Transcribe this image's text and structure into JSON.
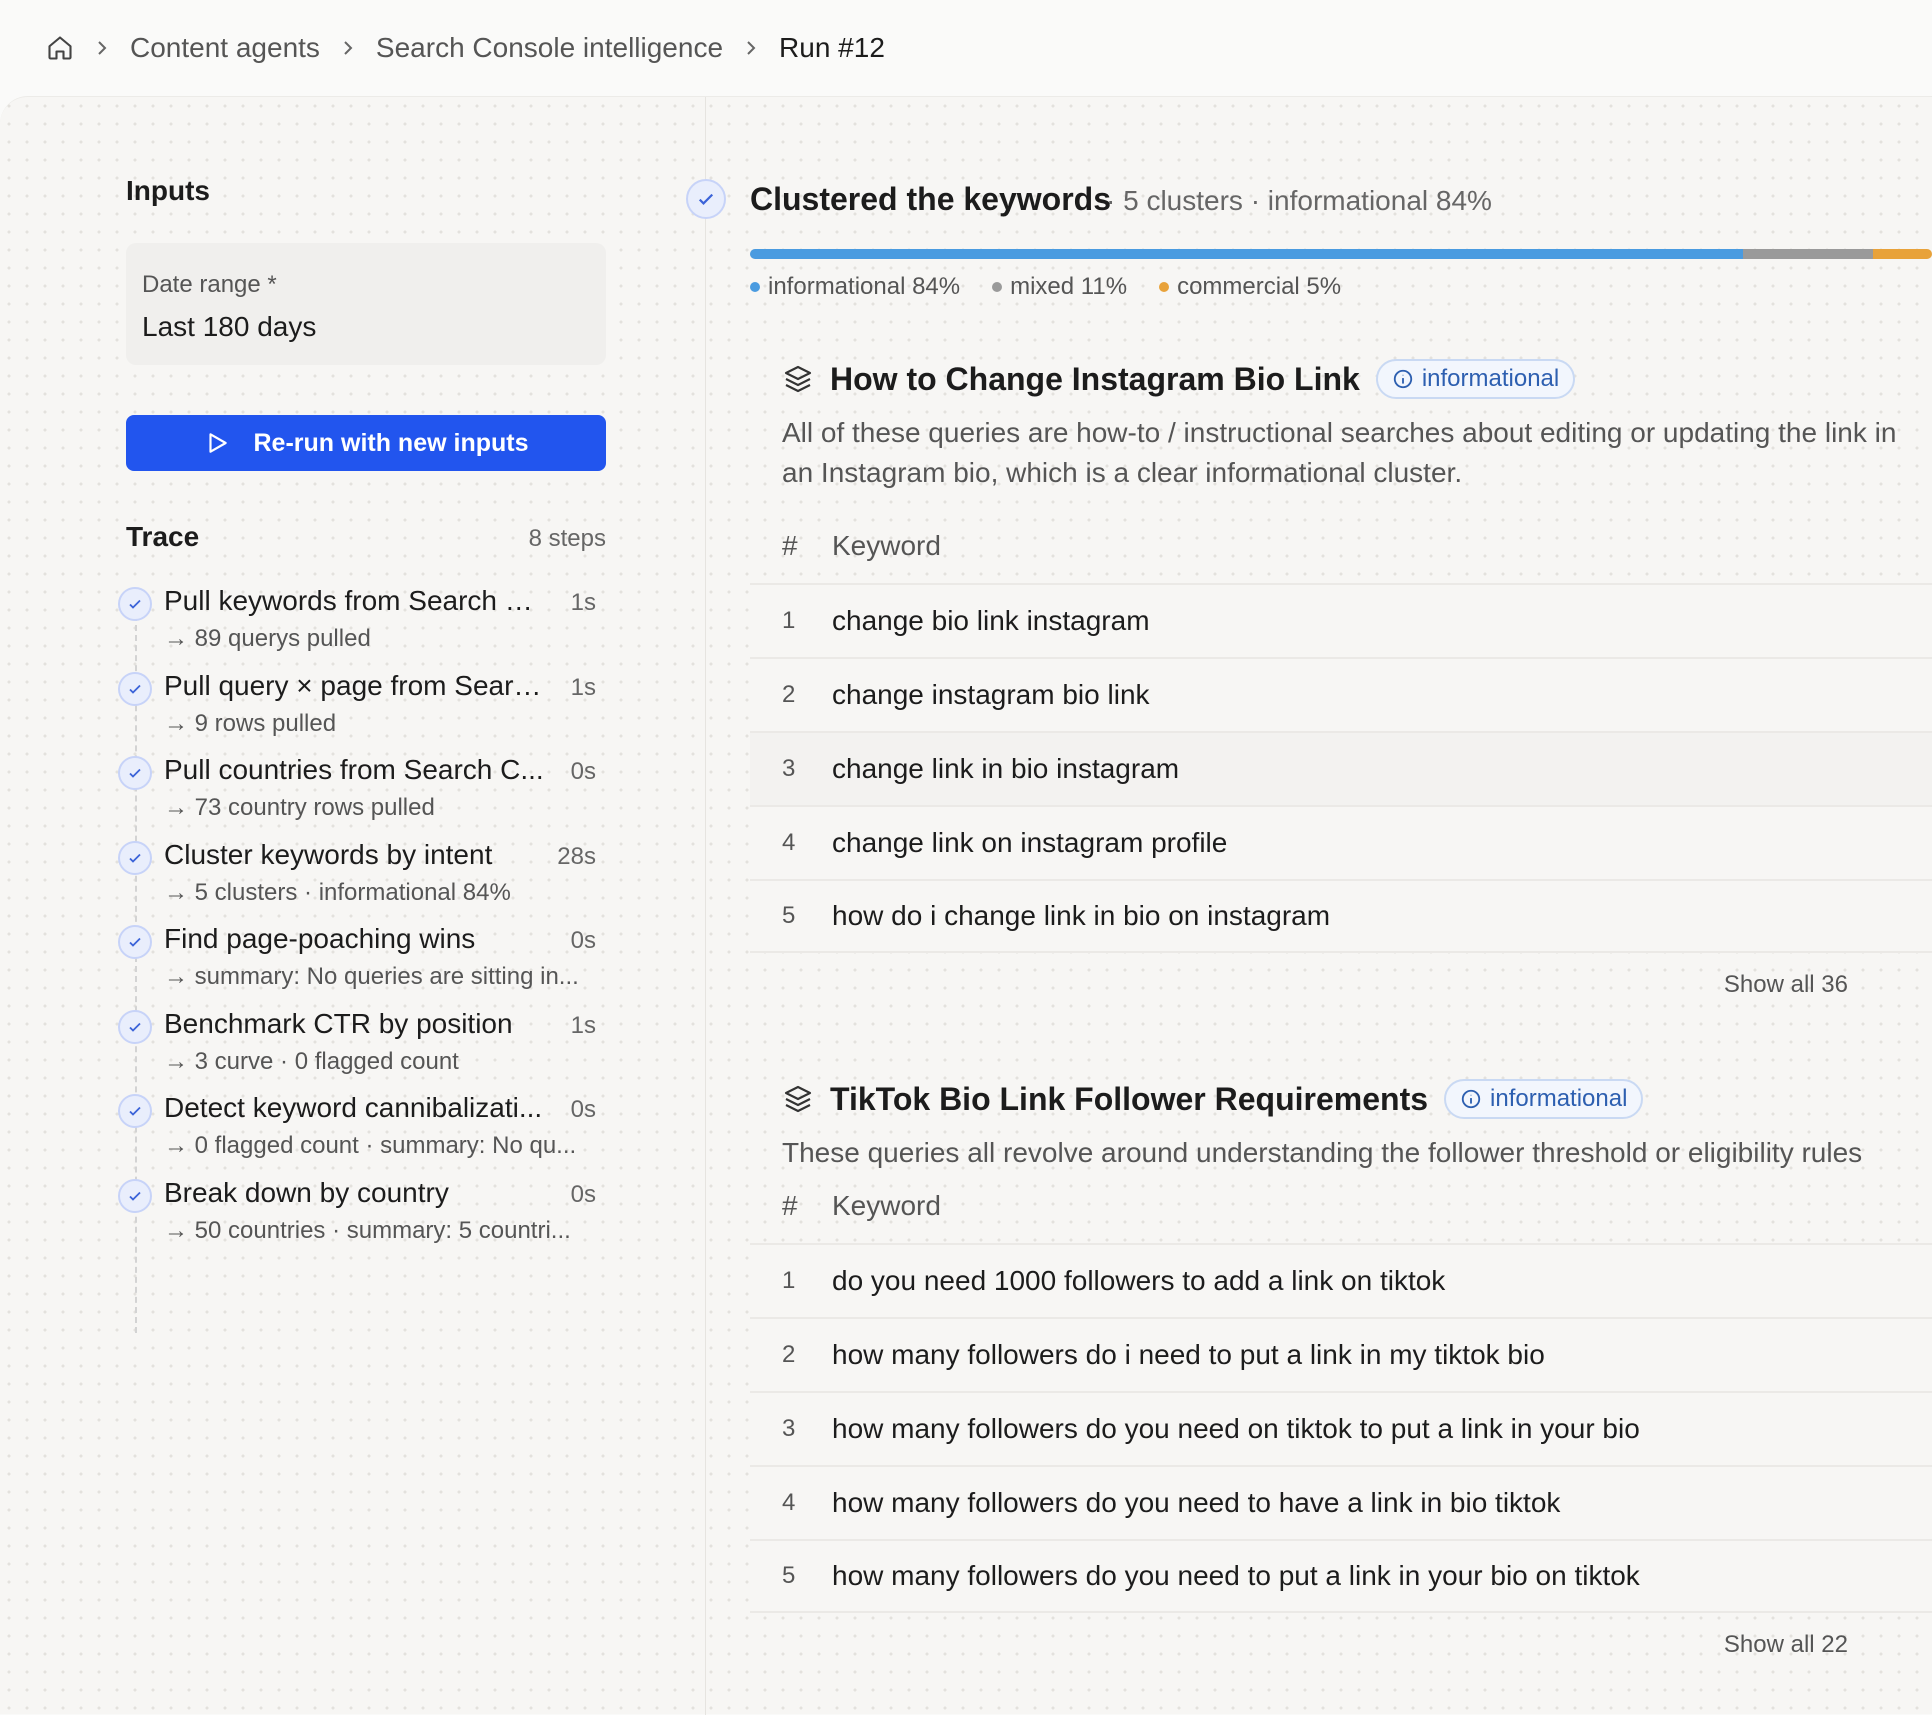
{
  "breadcrumb": {
    "items": [
      "Content agents",
      "Search Console intelligence",
      "Run #12"
    ]
  },
  "inputs": {
    "title": "Inputs",
    "date_range_label": "Date range *",
    "date_range_value": "Last 180 days",
    "rerun_label": "Re-run with new inputs"
  },
  "trace": {
    "title": "Trace",
    "count": "8 steps",
    "steps": [
      {
        "name": "Pull keywords from Search C...",
        "duration": "1s",
        "result": "→ 89 querys pulled"
      },
      {
        "name": "Pull query × page from Searc...",
        "duration": "1s",
        "result": "→ 9 rows pulled"
      },
      {
        "name": "Pull countries from Search C...",
        "duration": "0s",
        "result": "→ 73 country rows pulled"
      },
      {
        "name": "Cluster keywords by intent",
        "duration": "28s",
        "result": "→ 5 clusters · informational 84%"
      },
      {
        "name": "Find page-poaching wins",
        "duration": "0s",
        "result": "→ summary: No queries are sitting in..."
      },
      {
        "name": "Benchmark CTR by position",
        "duration": "1s",
        "result": "→ 3 curve · 0 flagged count"
      },
      {
        "name": "Detect keyword cannibalizati...",
        "duration": "0s",
        "result": "→ 0 flagged count · summary: No qu..."
      },
      {
        "name": "Break down by country",
        "duration": "0s",
        "result": "→ 50 countries · summary: 5 countri..."
      }
    ]
  },
  "main": {
    "title": "Clustered the keywords",
    "meta": "· 5 clusters · informational 84%",
    "intent": [
      {
        "label": "informational 84%",
        "share": 0.84,
        "color": "#4a9be0"
      },
      {
        "label": "mixed 11%",
        "share": 0.11,
        "color": "#9a9a9a"
      },
      {
        "label": "commercial 5%",
        "share": 0.05,
        "color": "#e8a23a"
      }
    ],
    "column_num": "#",
    "column_keyword": "Keyword",
    "clusters": [
      {
        "title": "How to Change Instagram Bio Link",
        "badge": "informational",
        "description": "All of these queries are how-to / instructional searches about editing or updating the link in an Instagram bio, which is a clear informational cluster.",
        "keywords": [
          "change bio link instagram",
          "change instagram bio link",
          "change link in bio instagram",
          "change link on instagram profile",
          "how do i change link in bio on instagram"
        ],
        "show_all": "Show all 36"
      },
      {
        "title": "TikTok Bio Link Follower Requirements",
        "badge": "informational",
        "description": "These queries all revolve around understanding the follower threshold or eligibility rules required to add a link to a TikTok bio.",
        "keywords": [
          "do you need 1000 followers to add a link on tiktok",
          "how many followers do i need to put a link in my tiktok bio",
          "how many followers do you need on tiktok to put a link in your bio",
          "how many followers do you need to have a link in bio tiktok",
          "how many followers do you need to put a link in your bio on tiktok"
        ],
        "show_all": "Show all 22"
      }
    ]
  }
}
